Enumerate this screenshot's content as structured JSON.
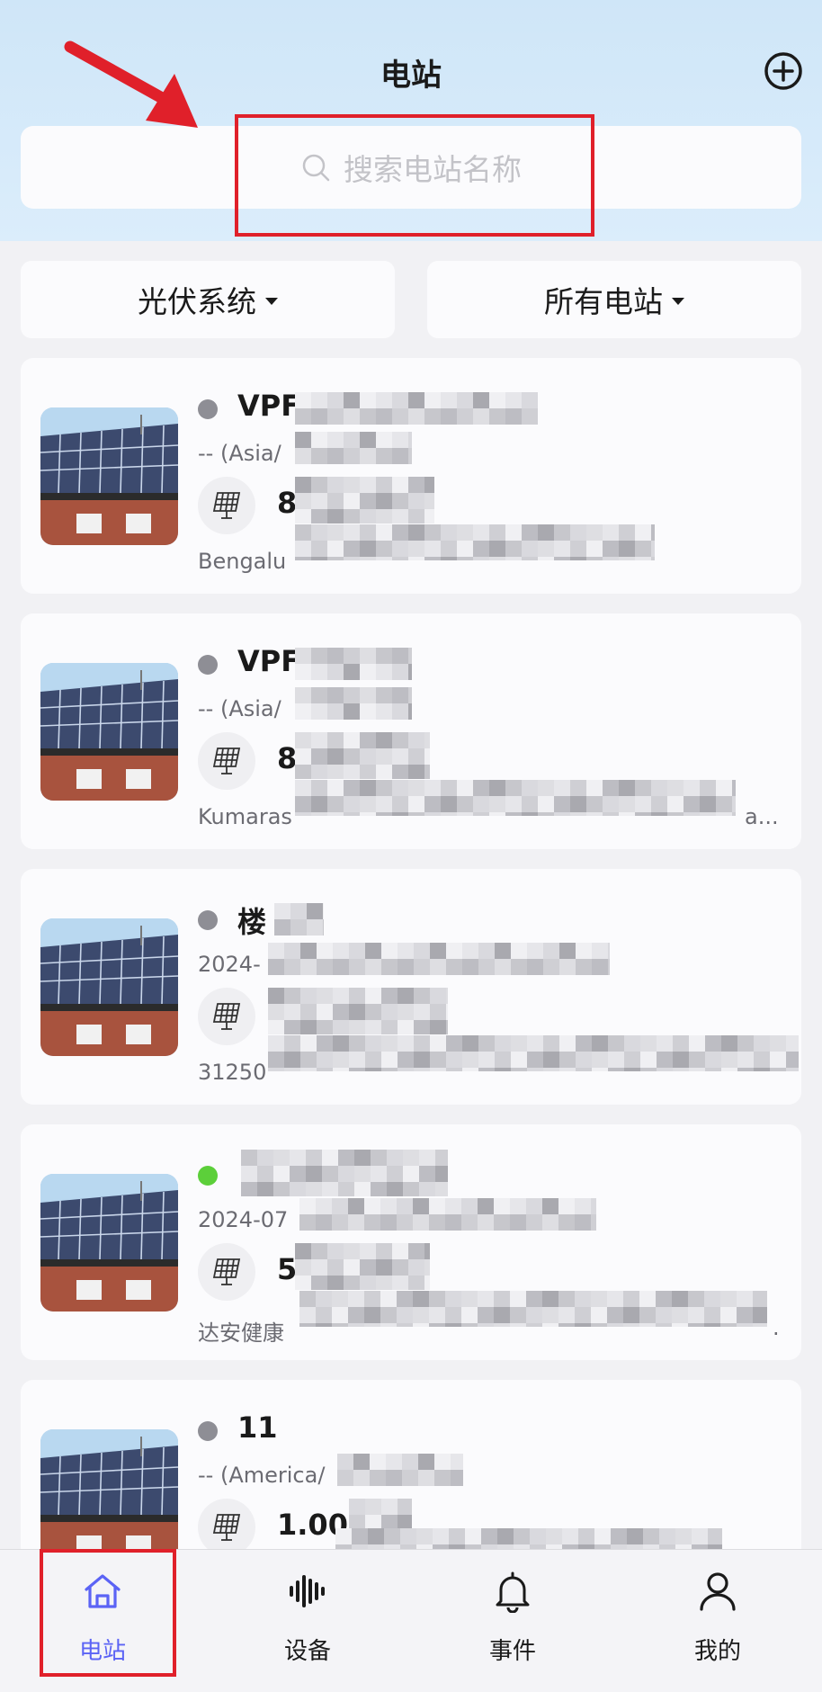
{
  "header": {
    "title": "电站",
    "search_placeholder": "搜索电站名称"
  },
  "filters": {
    "system_label": "光伏系统",
    "station_scope_label": "所有电站"
  },
  "stations": [
    {
      "name": "VPF",
      "subline": "-- (Asia/",
      "capacity": "8",
      "address": "Bengalu",
      "status": "offline"
    },
    {
      "name": "VPF",
      "subline": "-- (Asia/",
      "capacity": "8",
      "address": "Kumaras",
      "address_tail": "a...",
      "status": "offline"
    },
    {
      "name": "楼",
      "subline": "2024-",
      "capacity": "",
      "address": "31250",
      "status": "offline"
    },
    {
      "name": "",
      "subline": "2024-07",
      "capacity": "5",
      "address": "达安健康",
      "address_tail": ".",
      "status": "online"
    },
    {
      "name": "11",
      "subline": "-- (America/",
      "capacity": "1.00",
      "address": "",
      "status": "offline"
    }
  ],
  "tabs": [
    {
      "label": "电站",
      "icon": "home-icon",
      "active": true
    },
    {
      "label": "设备",
      "icon": "device-waveform-icon",
      "active": false
    },
    {
      "label": "事件",
      "icon": "bell-icon",
      "active": false
    },
    {
      "label": "我的",
      "icon": "user-icon",
      "active": false
    }
  ],
  "colors": {
    "status_offline": "#8e8e95",
    "status_online": "#5ccf3a",
    "accent": "#5b63f5",
    "annotation": "#e0202a"
  }
}
